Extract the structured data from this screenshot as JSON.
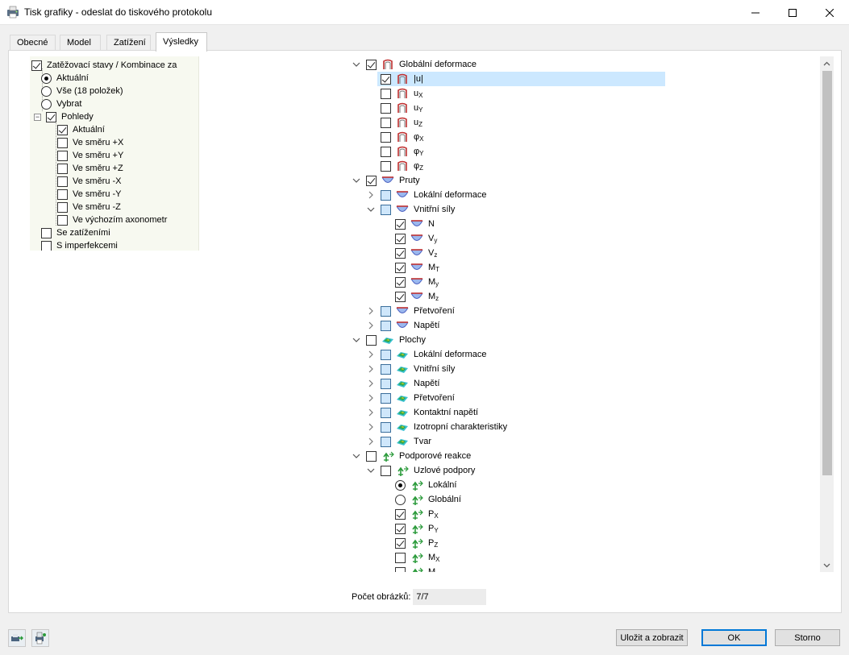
{
  "window": {
    "title": "Tisk grafiky - odeslat do tiskového protokolu",
    "minimize": "—",
    "maximize": "☐",
    "close": "✕"
  },
  "tabs": [
    {
      "label": "Obecné",
      "active": false
    },
    {
      "label": "Model",
      "active": false
    },
    {
      "label": "Zatížení",
      "active": false
    },
    {
      "label": "Výsledky",
      "active": true
    }
  ],
  "left_tree": {
    "load_cases": {
      "label": "Zatěžovací stavy / Kombinace za",
      "checked": true
    },
    "current": {
      "label": "Aktuální",
      "selected": true
    },
    "all": {
      "label": "Vše (18 položek)",
      "selected": false
    },
    "select": {
      "label": "Vybrat",
      "selected": false
    },
    "views": {
      "label": "Pohledy",
      "checked": true
    },
    "view_items": [
      {
        "label": "Aktuální",
        "checked": true
      },
      {
        "label": "Ve směru +X",
        "checked": false
      },
      {
        "label": "Ve směru +Y",
        "checked": false
      },
      {
        "label": "Ve směru +Z",
        "checked": false
      },
      {
        "label": "Ve směru -X",
        "checked": false
      },
      {
        "label": "Ve směru -Y",
        "checked": false
      },
      {
        "label": "Ve směru -Z",
        "checked": false
      },
      {
        "label": "Ve výchozím axonometr",
        "checked": false
      }
    ],
    "with_loads": {
      "label": "Se zatíženími",
      "checked": false
    },
    "with_imperfections": {
      "label": "S imperfekcemi",
      "checked": false
    }
  },
  "right_tree": {
    "global_deformation": {
      "label": "Globální deformace",
      "checked": true
    },
    "gd_items": [
      {
        "label": "|u|",
        "sub": "",
        "checked": true,
        "selected": true
      },
      {
        "label": "u",
        "sub": "X",
        "checked": false,
        "selected": false
      },
      {
        "label": "u",
        "sub": "Y",
        "checked": false,
        "selected": false
      },
      {
        "label": "u",
        "sub": "Z",
        "checked": false,
        "selected": false
      },
      {
        "label": "φ",
        "sub": "X",
        "checked": false,
        "selected": false
      },
      {
        "label": "φ",
        "sub": "Y",
        "checked": false,
        "selected": false
      },
      {
        "label": "φ",
        "sub": "Z",
        "checked": false,
        "selected": false
      }
    ],
    "members": {
      "label": "Pruty",
      "checked": true
    },
    "local_deformation": {
      "label": "Lokální deformace"
    },
    "internal_forces": {
      "label": "Vnitřní síly"
    },
    "if_items": [
      {
        "label": "N",
        "sub": "",
        "checked": true
      },
      {
        "label": "V",
        "sub": "y",
        "checked": true
      },
      {
        "label": "V",
        "sub": "z",
        "checked": true
      },
      {
        "label": "M",
        "sub": "T",
        "checked": true
      },
      {
        "label": "M",
        "sub": "y",
        "checked": true
      },
      {
        "label": "M",
        "sub": "z",
        "checked": true
      }
    ],
    "strains": {
      "label": "Přetvoření"
    },
    "stresses": {
      "label": "Napětí"
    },
    "surfaces": {
      "label": "Plochy",
      "checked": false
    },
    "surface_items": [
      {
        "label": "Lokální deformace"
      },
      {
        "label": "Vnitřní síly"
      },
      {
        "label": "Napětí"
      },
      {
        "label": "Přetvoření"
      },
      {
        "label": "Kontaktní napětí"
      },
      {
        "label": "Izotropní charakteristiky"
      },
      {
        "label": "Tvar"
      }
    ],
    "support_reactions": {
      "label": "Podporové reakce",
      "checked": false
    },
    "nodal_supports": {
      "label": "Uzlové podpory",
      "checked": false
    },
    "local": {
      "label": "Lokální",
      "selected": true
    },
    "global": {
      "label": "Globální",
      "selected": false
    },
    "reaction_items": [
      {
        "label": "P",
        "sub": "X",
        "checked": true
      },
      {
        "label": "P",
        "sub": "Y",
        "checked": true
      },
      {
        "label": "P",
        "sub": "Z",
        "checked": true
      },
      {
        "label": "M",
        "sub": "X",
        "checked": false
      },
      {
        "label": "M",
        "sub": "",
        "checked": false
      }
    ]
  },
  "image_count": {
    "label": "Počet obrázků:",
    "value": "7/7"
  },
  "buttons": {
    "save_show": "Uložit a zobrazit",
    "ok": "OK",
    "cancel": "Storno"
  },
  "colors": {
    "selection": "#cce8ff",
    "accent": "#0078d7",
    "tree_bg": "#f7f9f0"
  }
}
